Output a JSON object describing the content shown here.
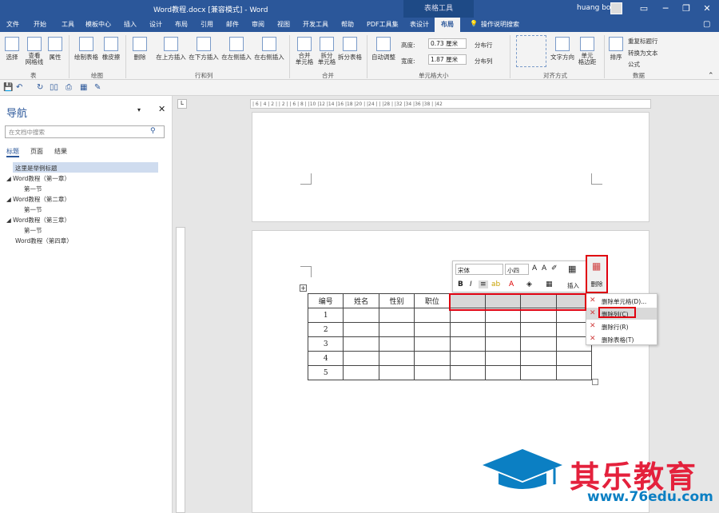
{
  "window": {
    "title": "Word教程.docx [兼容模式] - Word",
    "context_label": "表格工具",
    "user": "huang bo",
    "min_icon": "minimize-icon",
    "max_icon": "restore-icon",
    "close_icon": "close-icon"
  },
  "tabs": [
    "文件",
    "开始",
    "工具",
    "模板中心",
    "插入",
    "设计",
    "布局",
    "引用",
    "邮件",
    "审阅",
    "视图",
    "开发工具",
    "帮助",
    "PDF工具集",
    "表设计",
    "布局"
  ],
  "tell_me": "操作说明搜索",
  "ribbon": {
    "select": "选择",
    "gridlines": "查看\n网格线",
    "properties": "属性",
    "group_table": "表",
    "draw": "绘制表格",
    "eraser": "橡皮擦",
    "group_draw": "绘图",
    "delete": "删除",
    "insert_above": "在上方插入",
    "insert_below": "在下方插入",
    "insert_left": "在左侧插入",
    "insert_right": "在右侧插入",
    "group_rowcol": "行和列",
    "merge": "合并\n单元格",
    "split": "拆分\n单元格",
    "split_table": "拆分表格",
    "group_merge": "合并",
    "autofit": "自动调整",
    "height_label": "高度:",
    "height_value": "0.73 厘米",
    "width_label": "宽度:",
    "width_value": "1.87 厘米",
    "distribute_rows": "分布行",
    "distribute_cols": "分布列",
    "group_cellsize": "单元格大小",
    "text_dir": "文字方向",
    "cell_margins": "单元\n格边距",
    "group_align": "对齐方式",
    "sort": "排序",
    "repeat_header": "重复标题行",
    "convert": "转换为文本",
    "formula": "公式",
    "group_data": "数据"
  },
  "nav": {
    "title": "导航",
    "search_placeholder": "在文档中搜索",
    "tabs": [
      "标题",
      "页面",
      "结果"
    ],
    "items": [
      "这里是举例标题",
      "Word教程（第一章）",
      "第一节",
      "Word教程（第二章）",
      "第一节",
      "Word教程（第三章）",
      "第一节",
      "Word教程（第四章）"
    ]
  },
  "ruler": "| 6 |  4 |  2 |    |  2 |   | 6 |  8 |  |10 |12 |14 |16 |18 |20 |  |24 |  |  |28 |  |32 |34 |36 |38 |  |42",
  "table": {
    "headers": [
      "编号",
      "姓名",
      "性别",
      "职位",
      "",
      "",
      "",
      ""
    ],
    "rows": [
      "1",
      "2",
      "3",
      "4",
      "5"
    ]
  },
  "mini_toolbar": {
    "font": "宋体",
    "size": "小四",
    "insert": "插入",
    "delete": "删除"
  },
  "context_menu": [
    "删除单元格(D)...",
    "删除列(C)",
    "删除行(R)",
    "删除表格(T)"
  ],
  "watermark": {
    "brand": "其乐教育",
    "url": "www.76edu.com",
    "logo_icon": "graduation-cap-icon"
  }
}
